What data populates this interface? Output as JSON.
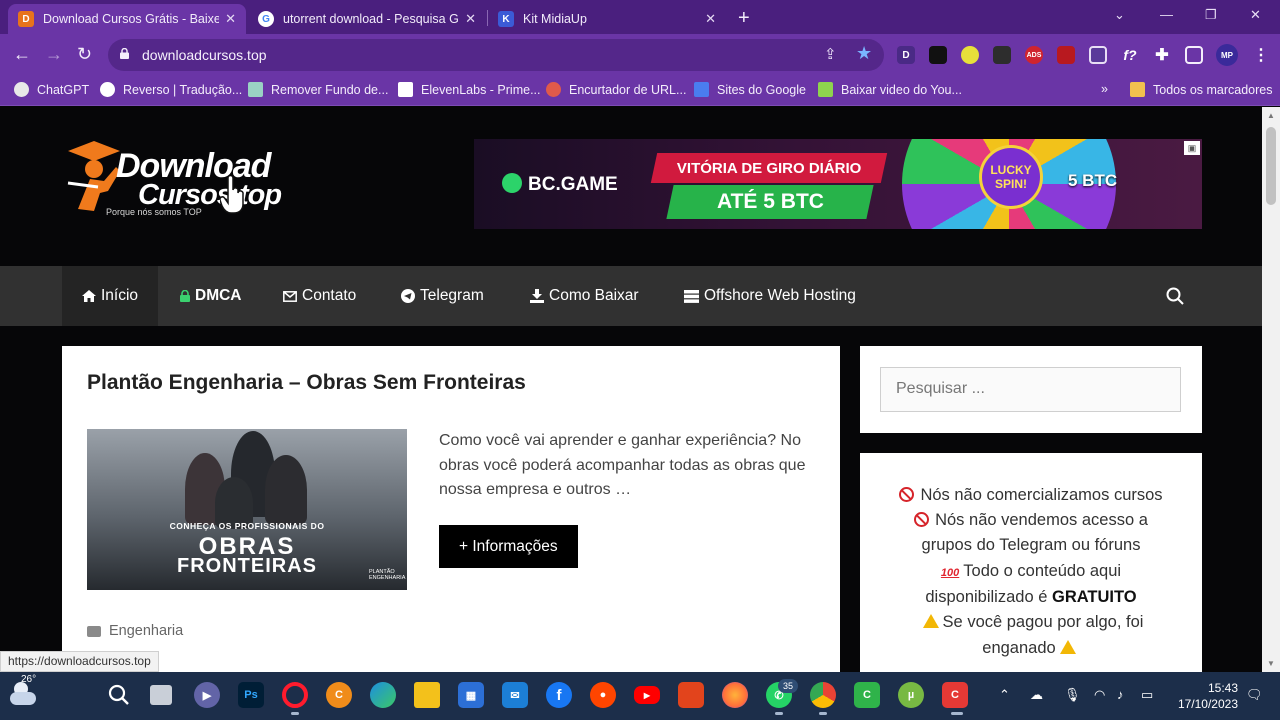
{
  "browser": {
    "tabs": [
      {
        "title": "Download Cursos Grátis - Baixe",
        "favicon": "D",
        "favicon_color": "#e8731c",
        "active": true
      },
      {
        "title": "utorrent download - Pesquisa G",
        "favicon": "G",
        "favicon_color": "#ffffff",
        "active": false
      },
      {
        "title": "Kit MidiaUp",
        "favicon": "K",
        "favicon_color": "#3b5bd6",
        "active": false
      }
    ],
    "url": "downloadcursos.top",
    "extensions": [
      "D",
      "",
      "",
      "",
      "ADS",
      "",
      "",
      "f?",
      "",
      "",
      "MP",
      ""
    ],
    "bookmarks": [
      {
        "label": "ChatGPT",
        "icon": "chatgpt-icon",
        "color": "#ffffff"
      },
      {
        "label": "Reverso | Tradução...",
        "icon": "reverso-icon",
        "color": "#ffffff"
      },
      {
        "label": "Remover Fundo de...",
        "icon": "remove-bg-icon",
        "color": "#9ad1c4"
      },
      {
        "label": "ElevenLabs - Prime...",
        "icon": "elevenlabs-icon",
        "color": "#ffffff"
      },
      {
        "label": "Encurtador de URL...",
        "icon": "shortener-icon",
        "color": "#e05a4a"
      },
      {
        "label": "Sites do Google",
        "icon": "google-sites-icon",
        "color": "#4a7df0"
      },
      {
        "label": "Baixar video do You...",
        "icon": "download-icon",
        "color": "#8ed34e"
      }
    ],
    "bookmarks_more": "»",
    "all_bookmarks": "Todos os marcadores"
  },
  "site": {
    "logo_line1": "Download",
    "logo_line2": "Cursos.top",
    "logo_tagline": "Porque nós somos TOP",
    "ad": {
      "brand": "BC.GAME",
      "headline1": "VITÓRIA DE GIRO DIÁRIO",
      "headline2": "ATÉ 5 BTC",
      "wheel_hub": "LUCKY SPIN!",
      "wheel_prize": "5 BTC"
    },
    "menu": [
      {
        "label": "Início",
        "icon": "home-icon"
      },
      {
        "label": "DMCA",
        "icon": "lock-icon"
      },
      {
        "label": "Contato",
        "icon": "envelope-icon"
      },
      {
        "label": "Telegram",
        "icon": "telegram-icon"
      },
      {
        "label": "Como Baixar",
        "icon": "download-icon"
      },
      {
        "label": "Offshore Web Hosting",
        "icon": "server-icon"
      }
    ],
    "post": {
      "title": "Plantão Engenharia – Obras Sem Fronteiras",
      "thumb_line1": "CONHEÇA OS PROFISSIONAIS DO",
      "thumb_line2": "OBRAS",
      "thumb_line3": "FRONTEIRAS",
      "thumb_brand": "PLANTÃO ENGENHARIA",
      "excerpt": "Como você vai aprender e ganhar experiência? No obras você poderá acompanhar todas as obras que nossa empresa e outros …",
      "more_button": "+ Informações",
      "category": "Engenharia"
    },
    "sidebar": {
      "search_placeholder": "Pesquisar ...",
      "notice": {
        "line1": "Nós não comercializamos cursos",
        "line2": "Nós não vendemos acesso a",
        "line3": "grupos do Telegram ou fóruns",
        "line4": "Todo o conteúdo aqui",
        "line5_prefix": "disponibilizado é",
        "line5_bold": "GRATUITO",
        "line6": "Se você pagou por algo, foi",
        "line7": "enganado"
      }
    },
    "status_url": "https://downloadcursos.top"
  },
  "taskbar": {
    "temperature": "26°",
    "whatsapp_badge": "35",
    "time": "15:43",
    "date": "17/10/2023",
    "apps": [
      {
        "name": "start",
        "color": "#4cc2ff"
      },
      {
        "name": "search",
        "color": "#ffffff"
      },
      {
        "name": "task-view",
        "color": "#ffffff"
      },
      {
        "name": "teams",
        "color": "#6264a7"
      },
      {
        "name": "photoshop",
        "color": "#001e36"
      },
      {
        "name": "opera",
        "color": "#ff1b2d"
      },
      {
        "name": "ccleaner",
        "color": "#f08c1a"
      },
      {
        "name": "edge",
        "color": "#1d8fe1"
      },
      {
        "name": "file-explorer",
        "color": "#f3c11b"
      },
      {
        "name": "microsoft-store",
        "color": "#2c6fd6"
      },
      {
        "name": "mail",
        "color": "#1c7fd6"
      },
      {
        "name": "facebook",
        "color": "#1877f2"
      },
      {
        "name": "reddit",
        "color": "#ff4500"
      },
      {
        "name": "youtube",
        "color": "#ff0000"
      },
      {
        "name": "office",
        "color": "#e2441c"
      },
      {
        "name": "firefox",
        "color": "#ff7139"
      },
      {
        "name": "whatsapp",
        "color": "#25d366"
      },
      {
        "name": "chrome",
        "color": "#1a73e8"
      },
      {
        "name": "camtasia",
        "color": "#2fb34a"
      },
      {
        "name": "utorrent",
        "color": "#78b943"
      },
      {
        "name": "recorder",
        "color": "#e53935"
      }
    ]
  }
}
